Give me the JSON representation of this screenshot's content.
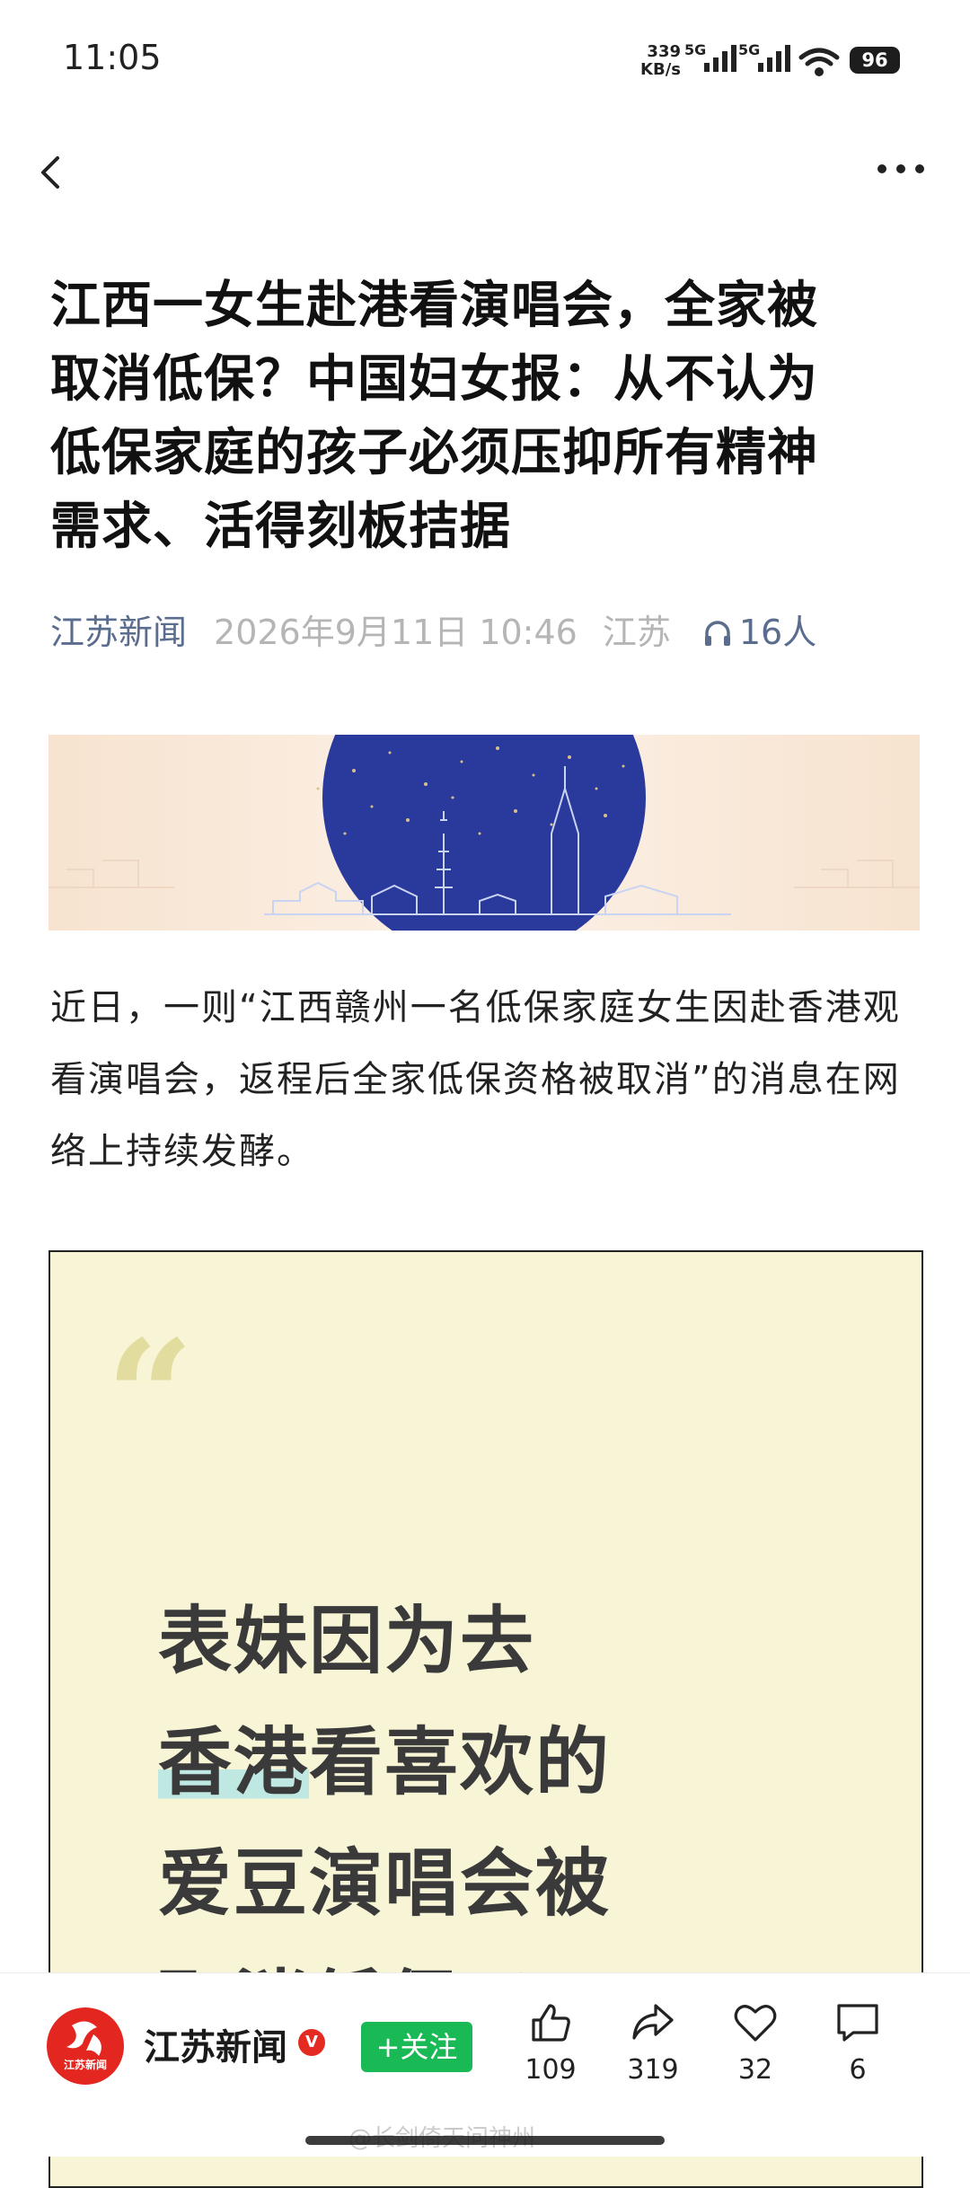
{
  "status_bar": {
    "time": "11:05",
    "net_speed_value": "339",
    "net_speed_unit": "KB/s",
    "sim1": "5G",
    "sim2": "5G",
    "battery": "96"
  },
  "nav": {
    "back_icon": "chevron-left-icon",
    "more_icon": "more-dots-icon"
  },
  "article": {
    "title_lines": [
      "江西一女生赴港看演唱会，全家被",
      "取消低保？中国妇女报：从不认为",
      "低保家庭的孩子必须压抑所有精神",
      "需求、活得刻板拮据"
    ],
    "meta": {
      "source": "江苏新闻",
      "datetime": "2026年9月11日 10:46",
      "location": "江苏",
      "listeners": "16人"
    },
    "paragraph": "近日，一则“江西赣州一名低保家庭女生因赴香港观看演唱会，返程后全家低保资格被取消”的消息在网络上持续发酵。",
    "quote_image": {
      "mark": "“",
      "line1": "表妹因为去",
      "line2_highlight": "香港",
      "line2_rest": "看喜欢的",
      "line3": "爱豆演唱会被",
      "line4": "取消低保了"
    }
  },
  "bottom_bar": {
    "logo_text": "江苏新闻",
    "publisher": "江苏新闻",
    "verified_mark": "V",
    "follow_label": "+关注",
    "likes": "109",
    "shares": "319",
    "favorites": "32",
    "comments": "6"
  },
  "watermark": "@长剑倚天问神州",
  "colors": {
    "accent_link": "#5a6d8e",
    "follow_green": "#19b955",
    "brand_red": "#e3261f",
    "quote_bg": "#f8f5d7",
    "banner_navy": "#2a3a9c"
  }
}
